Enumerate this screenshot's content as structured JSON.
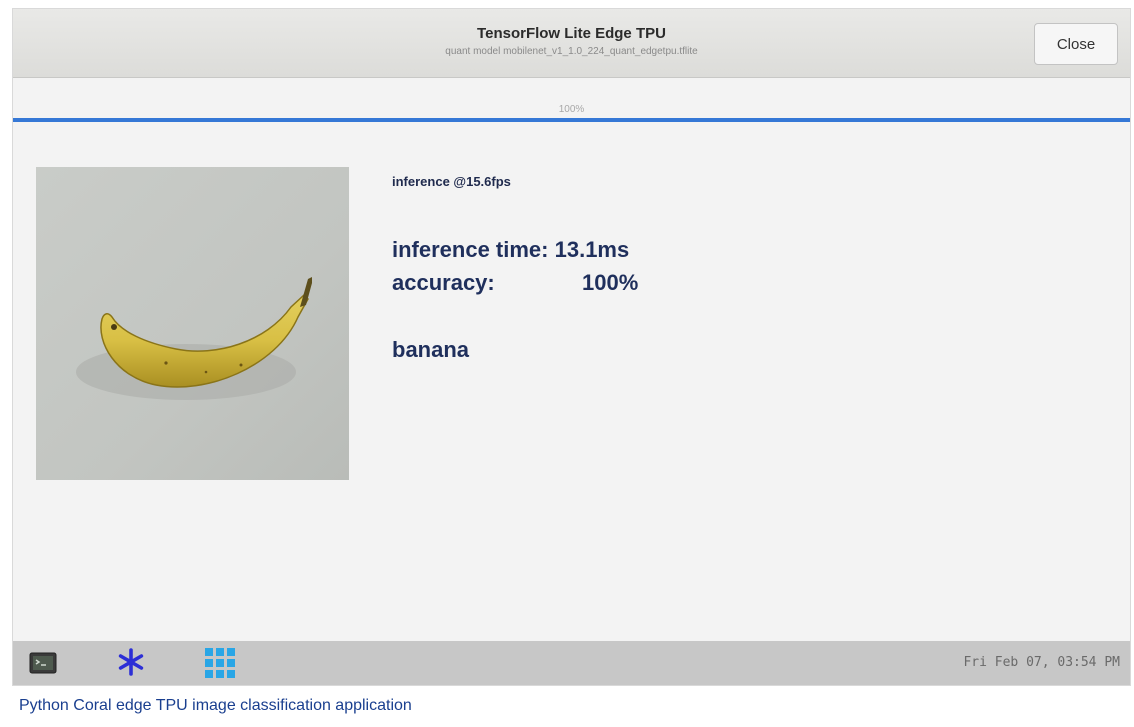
{
  "window": {
    "title": "TensorFlow Lite Edge TPU",
    "subtitle": "quant model mobilenet_v1_1.0_224_quant_edgetpu.tflite",
    "close_label": "Close"
  },
  "progress": {
    "label": "100%",
    "percent": 100,
    "color": "#3578d6"
  },
  "results": {
    "fps_text": "inference @15.6fps",
    "time_text": "inference time: 13.1ms",
    "accuracy_label": "accuracy:",
    "accuracy_value": "100%",
    "class_label": "banana",
    "text_color": "#1f2f5c"
  },
  "taskbar": {
    "icons": [
      "terminal-icon",
      "asterisk-icon",
      "grid-icon"
    ],
    "clock": "Fri Feb 07, 03:54 PM"
  },
  "caption": "Python Coral edge TPU image classification application"
}
